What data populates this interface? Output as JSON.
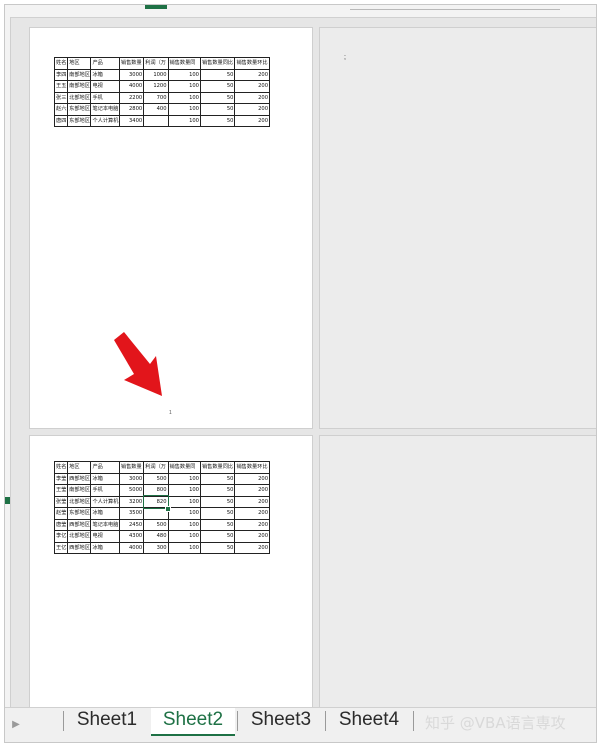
{
  "sheet_tabs": [
    "Sheet1",
    "Sheet2",
    "Sheet3",
    "Sheet4"
  ],
  "active_tab": "Sheet2",
  "watermark": "知乎 @VBA语言専攻",
  "colors": {
    "accent": "#1e7145",
    "arrow": "#e2151b"
  },
  "page1": {
    "headers": [
      "姓名",
      "地区",
      "产品",
      "销售数量",
      "利润（万",
      "销售数量同",
      "销售数量同比",
      "销售数量环比"
    ],
    "rows": [
      [
        "李四",
        "南部地区",
        "冰箱",
        "3000",
        "1000",
        "100",
        "50",
        "200"
      ],
      [
        "王五",
        "南部地区",
        "电视",
        "4000",
        "1200",
        "100",
        "50",
        "200"
      ],
      [
        "张三",
        "北部地区",
        "手机",
        "2200",
        "700",
        "100",
        "50",
        "200"
      ],
      [
        "赵六",
        "东部地区",
        "笔记本电脑",
        "2800",
        "400",
        "100",
        "50",
        "200"
      ],
      [
        "唐四",
        "东部地区",
        "个人计算机",
        "3400",
        "",
        "100",
        "50",
        "200"
      ]
    ],
    "page_number": "1"
  },
  "page2_text": ";",
  "page3": {
    "headers": [
      "姓名",
      "地区",
      "产品",
      "销售数量",
      "利润（万",
      "销售数量同",
      "销售数量同比",
      "销售数量环比"
    ],
    "rows": [
      [
        "李莹",
        "西部地区",
        "冰箱",
        "3000",
        "500",
        "100",
        "50",
        "200"
      ],
      [
        "王莹",
        "南部地区",
        "手机",
        "5000",
        "800",
        "100",
        "50",
        "200"
      ],
      [
        "张莹",
        "北部地区",
        "个人计算机",
        "3200",
        "820",
        "100",
        "50",
        "200"
      ],
      [
        "赵莹",
        "东部地区",
        "冰箱",
        "3500",
        "",
        "100",
        "50",
        "200"
      ],
      [
        "唐莹",
        "西部地区",
        "笔记本电脑",
        "2450",
        "500",
        "100",
        "50",
        "200"
      ],
      [
        "李亿",
        "北部地区",
        "电视",
        "4300",
        "480",
        "100",
        "50",
        "200"
      ],
      [
        "王亿",
        "西部地区",
        "冰箱",
        "4000",
        "300",
        "100",
        "50",
        "200"
      ]
    ]
  }
}
